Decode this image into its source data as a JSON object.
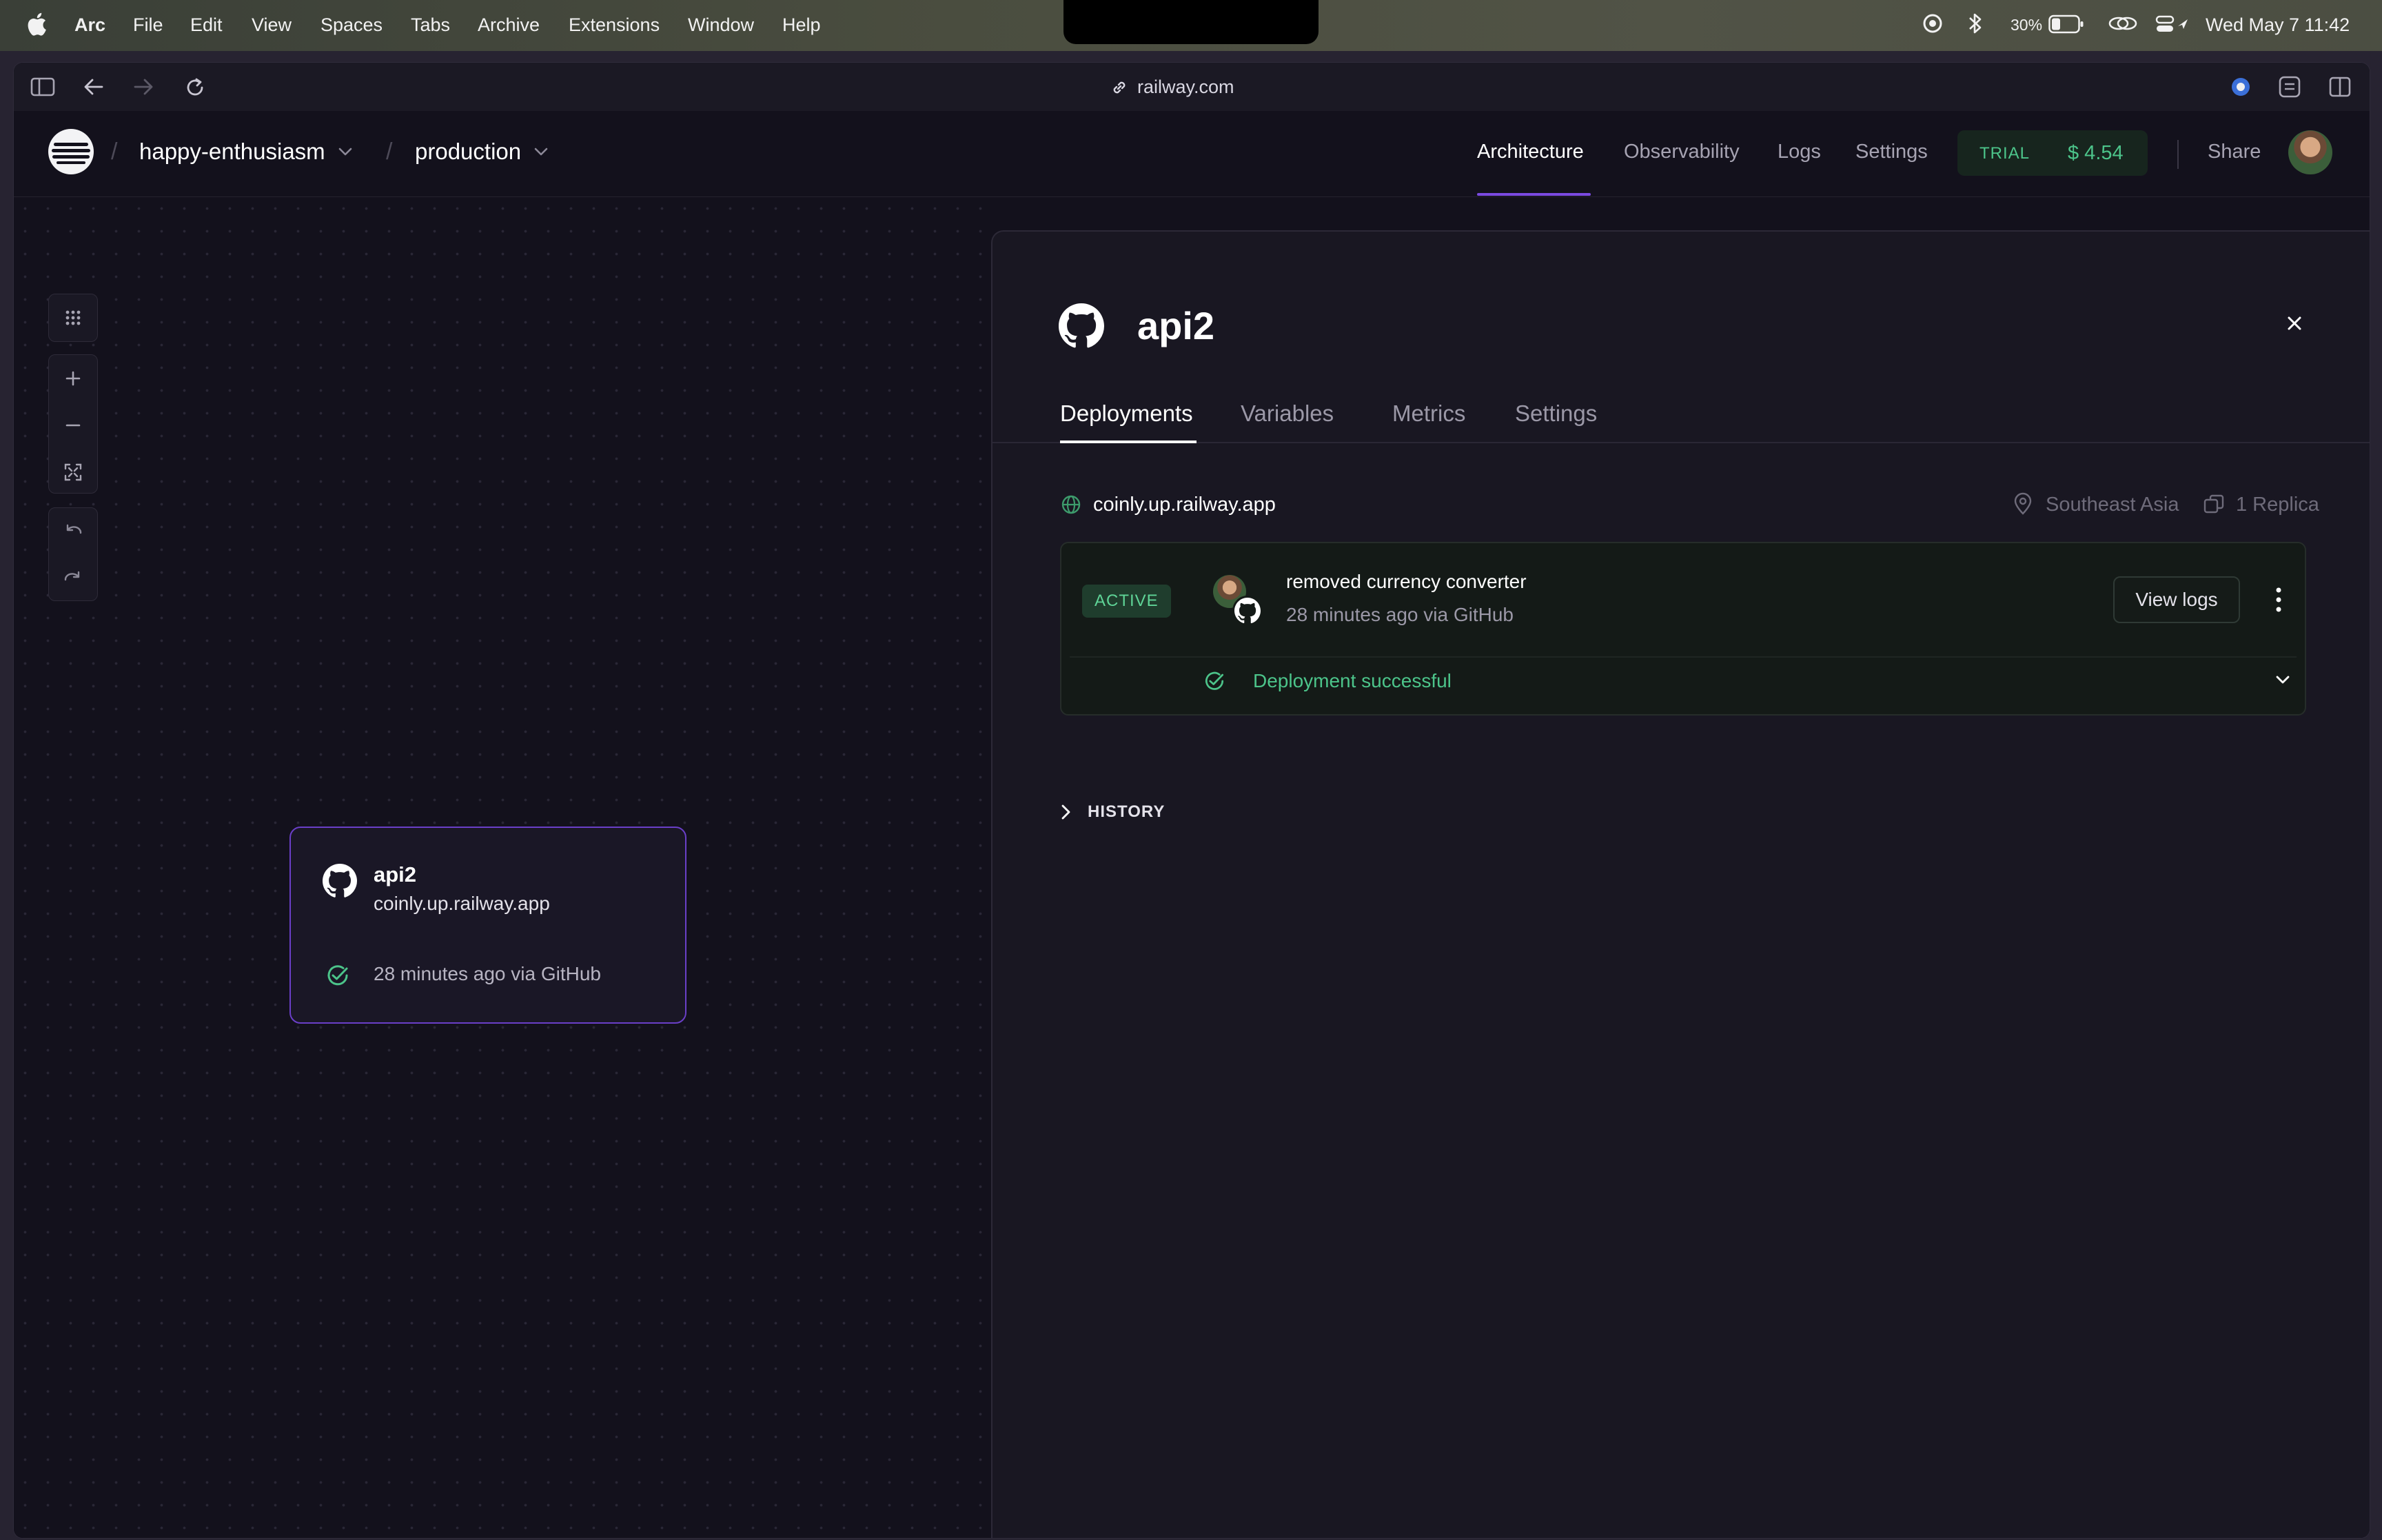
{
  "menubar": {
    "app_name": "Arc",
    "items": [
      "File",
      "Edit",
      "View",
      "Spaces",
      "Tabs",
      "Archive",
      "Extensions",
      "Window",
      "Help"
    ],
    "battery": "30%",
    "clock": "Wed May 7  11:42"
  },
  "browser": {
    "url": "railway.com"
  },
  "header": {
    "project": "happy-enthusiasm",
    "environment": "production",
    "nav": [
      "Architecture",
      "Observability",
      "Logs",
      "Settings"
    ],
    "active_nav": "Architecture",
    "trial_label": "TRIAL",
    "trial_amount": "$ 4.54",
    "share": "Share"
  },
  "service_card": {
    "name": "api2",
    "domain": "coinly.up.railway.app",
    "status": "28 minutes ago via GitHub"
  },
  "panel": {
    "title": "api2",
    "tabs": [
      "Deployments",
      "Variables",
      "Metrics",
      "Settings"
    ],
    "active_tab": "Deployments",
    "domain": "coinly.up.railway.app",
    "region": "Southeast Asia",
    "replicas": "1 Replica",
    "deployment": {
      "badge": "ACTIVE",
      "message": "removed currency converter",
      "meta": "28 minutes ago via GitHub",
      "view_logs": "View logs",
      "status": "Deployment successful"
    },
    "history_label": "HISTORY"
  },
  "colors": {
    "accent_purple": "#7b4ae0",
    "success_green": "#4cc48a",
    "background": "#13111c"
  }
}
